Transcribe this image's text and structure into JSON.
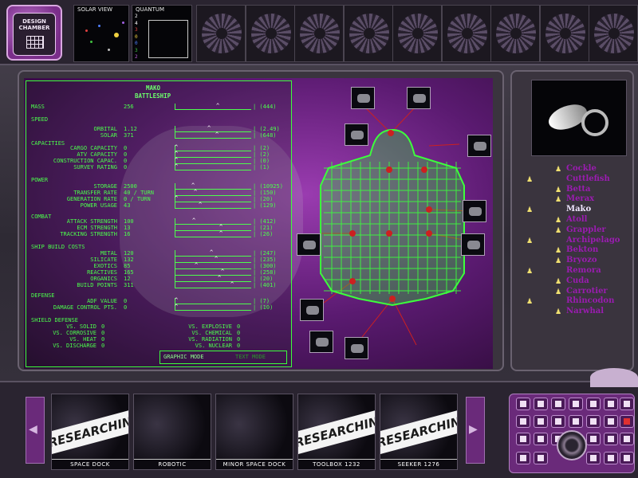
{
  "top": {
    "design_chamber_label": "DESIGN\nCHAMBER",
    "solar_view_caption": "SOLAR VIEW",
    "quantum_caption": "QUANTUM",
    "quantum_numbers": [
      "2",
      "4",
      "3",
      "0",
      "0",
      "3",
      "2"
    ],
    "flower_slots": 9
  },
  "stats": {
    "ship_name": "MAKO",
    "ship_class": "BATTLESHIP",
    "sections": {
      "mass": "MASS",
      "speed": "SPEED",
      "capacities": "CAPACITIES",
      "power": "POWER",
      "combat": "COMBAT",
      "build": "SHIP BUILD COSTS",
      "defense": "DEFENSE",
      "shield": "SHIELD DEFENSE"
    },
    "rows": [
      {
        "label": "MASS",
        "value": "256",
        "max": "| (444)",
        "fill": 0.58
      },
      {
        "label": "ORBITAL",
        "value": "1.12",
        "max": "| (2.49)",
        "fill": 0.45
      },
      {
        "label": "SOLAR",
        "value": "371",
        "max": "| (648)",
        "fill": 0.57
      },
      {
        "label": "CARGO CAPACITY",
        "value": "0",
        "max": "| (2)",
        "fill": 0.0
      },
      {
        "label": "ATV CAPACITY",
        "value": "0",
        "max": "| (2)",
        "fill": 0.0
      },
      {
        "label": "CONSTRUCTION CAPAC.",
        "value": "0",
        "max": "| (0)",
        "fill": 0.0
      },
      {
        "label": "SURVEY RATING",
        "value": "0",
        "max": "| (1)",
        "fill": 0.0
      },
      {
        "label": "STORAGE",
        "value": "2500",
        "max": "| (10925)",
        "fill": 0.23
      },
      {
        "label": "TRANSFER RATE",
        "value": "40 / TURN",
        "max": "| (150)",
        "fill": 0.27
      },
      {
        "label": "GENERATION RATE",
        "value": "0 / TURN",
        "max": "| (20)",
        "fill": 0.0
      },
      {
        "label": "POWER USAGE",
        "value": "43",
        "max": "| (129)",
        "fill": 0.33
      },
      {
        "label": "ATTACK STRENGTH",
        "value": "100",
        "max": "| (412)",
        "fill": 0.24
      },
      {
        "label": "ECM STRENGTH",
        "value": "13",
        "max": "| (21)",
        "fill": 0.62
      },
      {
        "label": "TRACKING STRENGTH",
        "value": "16",
        "max": "| (26)",
        "fill": 0.62
      },
      {
        "label": "METAL",
        "value": "120",
        "max": "| (247)",
        "fill": 0.49
      },
      {
        "label": "SILICATE",
        "value": "132",
        "max": "| (235)",
        "fill": 0.56
      },
      {
        "label": "EXOTICS",
        "value": "85",
        "max": "| (300)",
        "fill": 0.28
      },
      {
        "label": "REACTIVES",
        "value": "165",
        "max": "| (258)",
        "fill": 0.64
      },
      {
        "label": "ORGANICS",
        "value": "12",
        "max": "| (20)",
        "fill": 0.6
      },
      {
        "label": "BUILD POINTS",
        "value": "311",
        "max": "| (401)",
        "fill": 0.78
      },
      {
        "label": "ADF VALUE",
        "value": "0",
        "max": "| (7)",
        "fill": 0.0
      },
      {
        "label": "DAMAGE CONTROL PTS.",
        "value": "0",
        "max": "| (10)",
        "fill": 0.0
      }
    ],
    "shield": [
      {
        "label": "VS. SOLID",
        "value": "0"
      },
      {
        "label": "VS. CORROSIVE",
        "value": "0"
      },
      {
        "label": "VS. HEAT",
        "value": "0"
      },
      {
        "label": "VS. DISCHARGE",
        "value": "0"
      },
      {
        "label": "VS. EXPLOSIVE",
        "value": "0"
      },
      {
        "label": "VS. CHEMICAL",
        "value": "0"
      },
      {
        "label": "VS. RADIATION",
        "value": "0"
      },
      {
        "label": "VS. NUCLEAR",
        "value": "0"
      }
    ],
    "mode_graphic": "GRAPHIC MODE",
    "mode_text": "TEXT MODE"
  },
  "ships": {
    "selected": "Mako",
    "items": [
      "Cockle",
      "Cuttlefish",
      "Betta",
      "Merax",
      "Mako",
      "Atoll",
      "Grappler",
      "Archipelago",
      "Bekton",
      "Bryozo",
      "Remora",
      "Cuda",
      "Carrotier",
      "Rhincodon",
      "Narwhal"
    ]
  },
  "queue": [
    {
      "label": "SPACE DOCK",
      "status": "RESEARCHING"
    },
    {
      "label": "ROBOTIC CONSTRUCTION",
      "status": ""
    },
    {
      "label": "MINOR SPACE DOCK",
      "status": ""
    },
    {
      "label": "TOOLBOX 1232",
      "status": "RESEARCHING"
    },
    {
      "label": "SEEKER 1276",
      "status": "RESEARCHING"
    }
  ],
  "colors": {
    "accent": "#9a1cb0",
    "hud_green": "#3cff3c",
    "panel": "#3a343e"
  }
}
